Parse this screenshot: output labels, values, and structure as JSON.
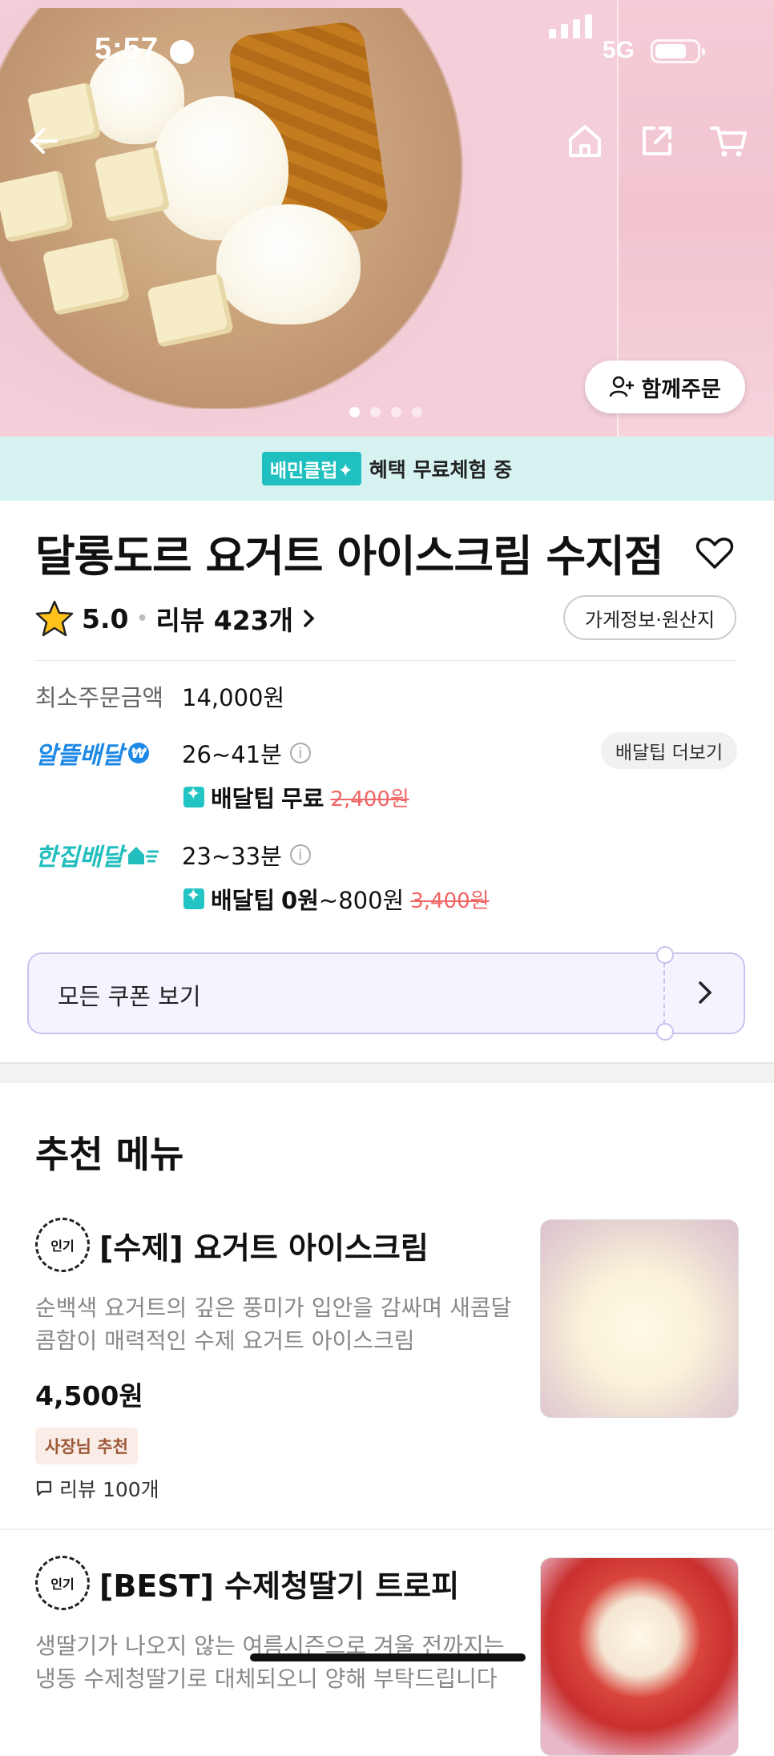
{
  "status": {
    "time": "5:57",
    "network": "5G"
  },
  "hero": {
    "together_label": "함께주문",
    "dots": 4,
    "active_dot": 0
  },
  "club": {
    "badge": "배민클럽✦",
    "text": "혜택 무료체험 중"
  },
  "store": {
    "name": "달롱도르 요거트 아이스크림 수지점",
    "rating": "5.0",
    "reviews": "리뷰 423개",
    "info_button": "가게정보·원산지"
  },
  "order": {
    "min_label": "최소주문금액",
    "min_value": "14,000원"
  },
  "delivery": [
    {
      "brand": "알뜰배달",
      "brand_color": "#1e88e5",
      "time": "26~41분",
      "tip_label": "배달팁",
      "tip_value": "무료",
      "tip_range": "",
      "original": "2,400원"
    },
    {
      "brand": "한집배달",
      "brand_color": "#22bdbd",
      "time": "23~33분",
      "tip_label": "배달팁",
      "tip_value": "0원",
      "tip_range": "~800원",
      "original": "3,400원"
    }
  ],
  "tip_more": "배달팁 더보기",
  "coupon": {
    "label": "모든 쿠폰 보기"
  },
  "recommend": {
    "heading": "추천 메뉴",
    "items": [
      {
        "badge": "인기",
        "name": "[수제] 요거트 아이스크림",
        "desc": "순백색 요거트의 깊은 풍미가 입안을 감싸며 새콤달콤함이 매력적인 수제 요거트 아이스크림",
        "desc_line1": "순백색 요거트의 깊은 풍미가 입안을 감싸며 새콤달",
        "desc_line2": "콤함이 매력적인 수제 요거트 아이스크림",
        "price": "4,500원",
        "tag": "사장님 추천",
        "reviews": "리뷰 100개"
      },
      {
        "badge": "인기",
        "name": "[BEST] 수제청딸기 트로피",
        "desc_line1": "생딸기가 나오지 않는 여름시즌으로 겨울 전까지는",
        "desc_line2": "냉동 수제청딸기로 대체되오니 양해 부탁드립니다"
      }
    ]
  }
}
